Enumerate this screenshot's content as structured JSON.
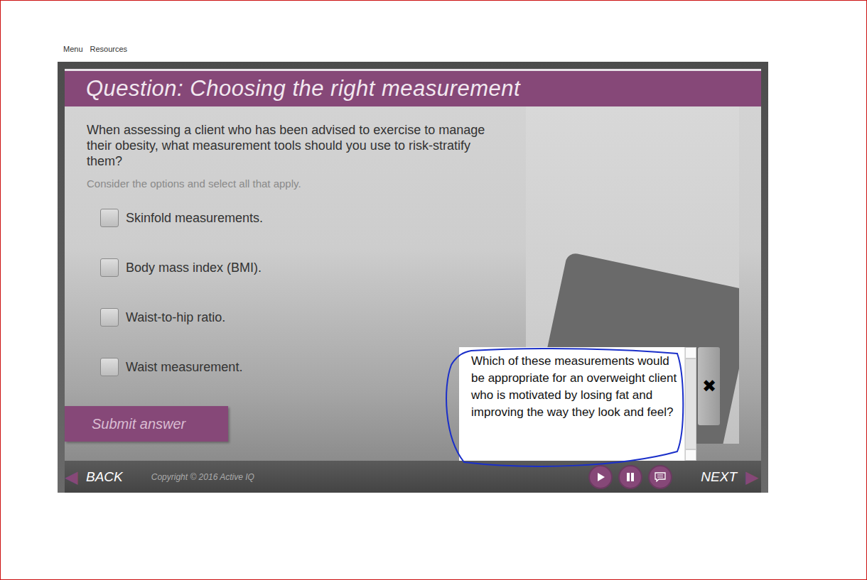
{
  "nav": [
    "Menu",
    "Resources"
  ],
  "title": "Question: Choosing the right measurement",
  "question": "When assessing a client who has been advised to exercise to manage their obesity, what measurement tools should you use to risk-stratify them?",
  "instruction": "Consider the options and select all that apply.",
  "options": [
    {
      "label": "Skinfold measurements.",
      "checked": false
    },
    {
      "label": "Body mass index (BMI).",
      "checked": false
    },
    {
      "label": "Waist-to-hip ratio.",
      "checked": false
    },
    {
      "label": "Waist measurement.",
      "checked": false
    }
  ],
  "submit": "Submit answer",
  "tooltip": {
    "text": "Which of these measurements would be appropriate for an overweight client who is motivated by losing fat and improving the way they look and feel?",
    "close": "✖"
  },
  "footer": {
    "back_icon": "◀",
    "back": "BACK",
    "copyright": "Copyright © 2016 Active IQ",
    "next": "NEXT",
    "next_icon": "▶"
  }
}
